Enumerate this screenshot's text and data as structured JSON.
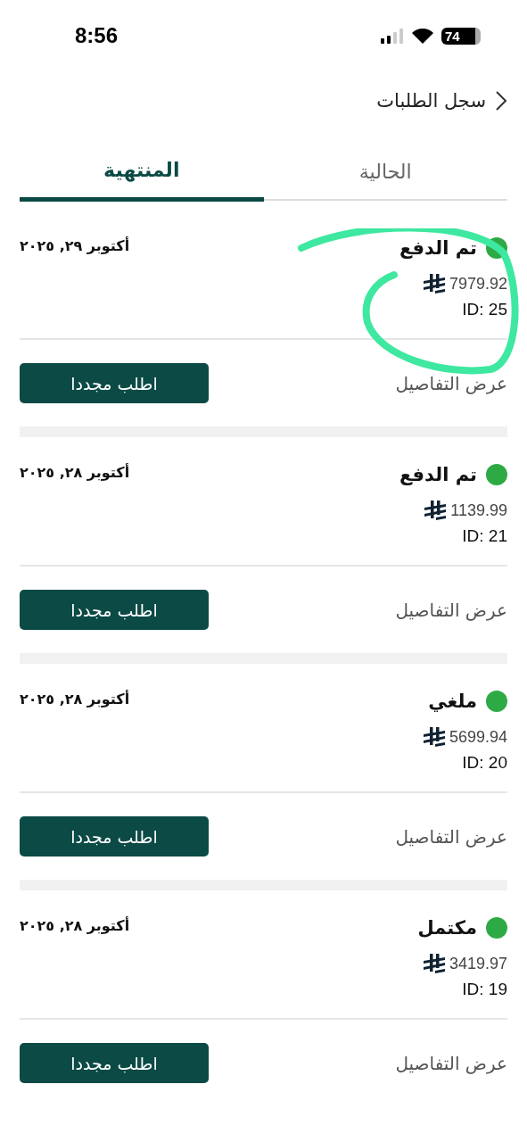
{
  "status_bar": {
    "time": "8:56",
    "battery": "74"
  },
  "header": {
    "title": "سجل الطلبات"
  },
  "tabs": [
    {
      "label": "الحالية",
      "selected": false
    },
    {
      "label": "المنتهية",
      "selected": true
    }
  ],
  "orders": [
    {
      "status": "تم الدفع",
      "color": "#2eaa45",
      "amount": "7979.92",
      "id": "ID: 25",
      "date": "أكتوبر ٢٩, ٢٠٢٥",
      "details": "عرض التفاصيل",
      "reorder": "اطلب مجددا",
      "highlighted": true
    },
    {
      "status": "تم الدفع",
      "color": "#2eaa45",
      "amount": "1139.99",
      "id": "ID: 21",
      "date": "أكتوبر ٢٨, ٢٠٢٥",
      "details": "عرض التفاصيل",
      "reorder": "اطلب مجددا",
      "highlighted": false
    },
    {
      "status": "ملغي",
      "color": "#2eaa45",
      "amount": "5699.94",
      "id": "ID: 20",
      "date": "أكتوبر ٢٨, ٢٠٢٥",
      "details": "عرض التفاصيل",
      "reorder": "اطلب مجددا",
      "highlighted": false
    },
    {
      "status": "مكتمل",
      "color": "#2eaa45",
      "amount": "3419.97",
      "id": "ID: 19",
      "date": "أكتوبر ٢٨, ٢٠٢٥",
      "details": "عرض التفاصيل",
      "reorder": "اطلب مجددا",
      "highlighted": false
    }
  ]
}
